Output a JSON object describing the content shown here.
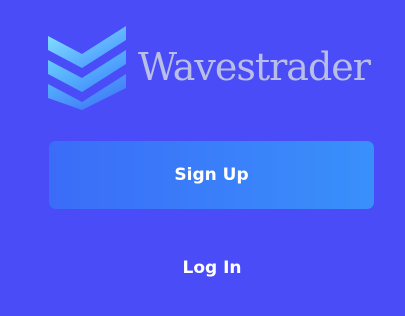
{
  "brand": {
    "name": "Wavestrader",
    "logo_icon": "layered-chevron-icon",
    "mark_color_top": "#7ee2ff",
    "mark_color_bottom": "#3a8cff",
    "name_color": "#b9bee6"
  },
  "actions": {
    "signup_label": "Sign Up",
    "login_label": "Log In"
  },
  "colors": {
    "background": "#4a4df7",
    "button_gradient_start": "#3b6cf8",
    "button_gradient_end": "#3990fb",
    "button_text": "#ffffff"
  }
}
